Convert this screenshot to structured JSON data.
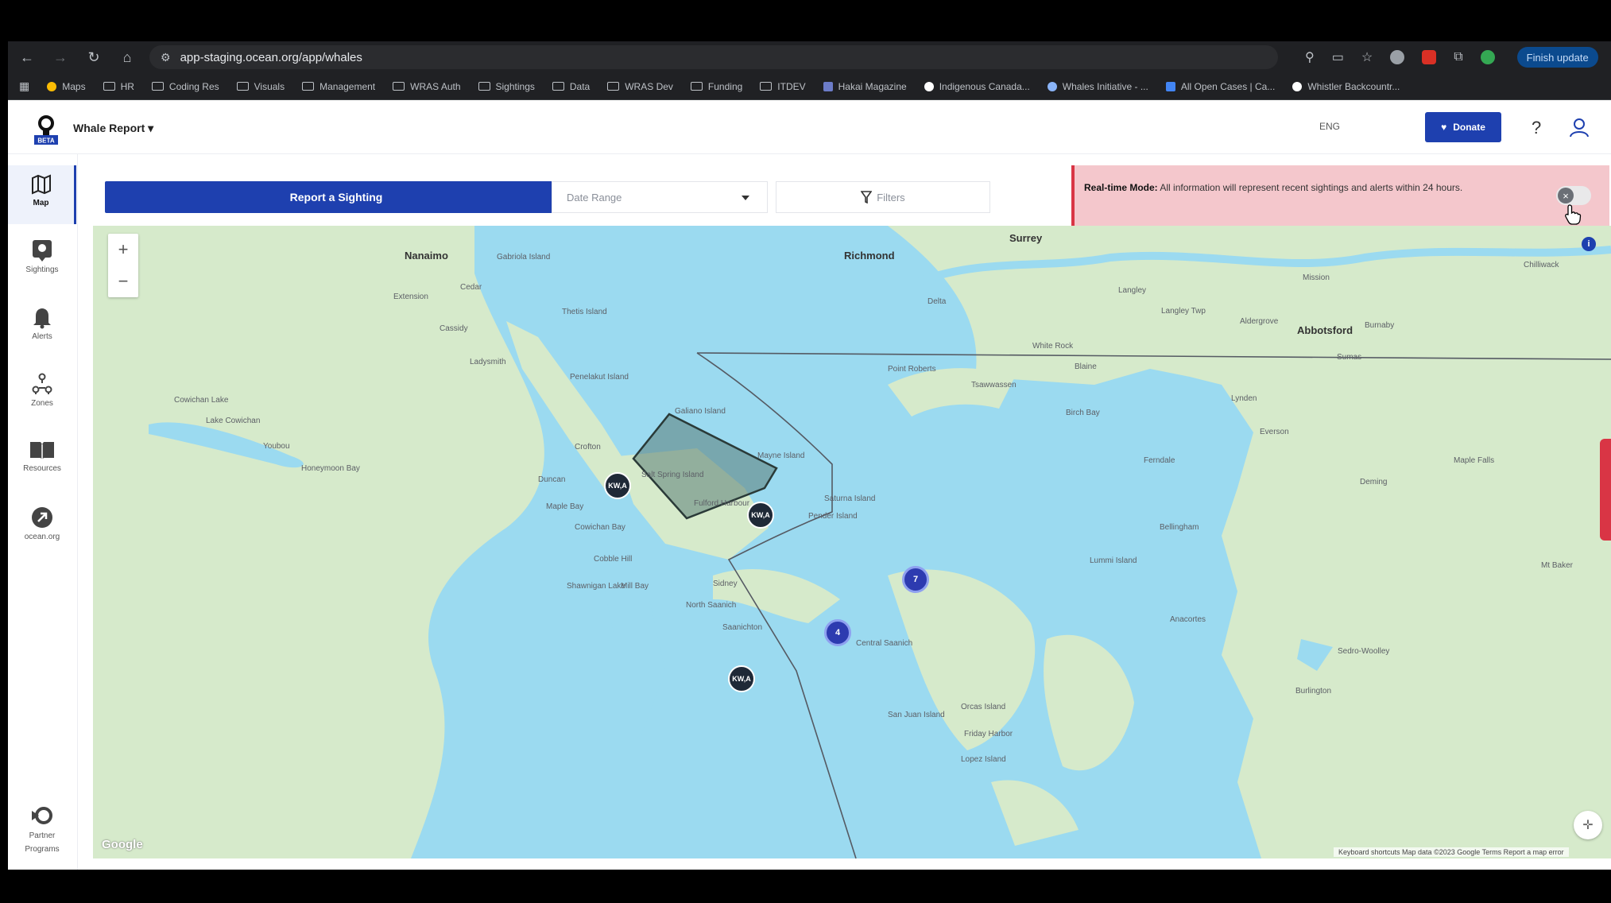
{
  "browser": {
    "url": "app-staging.ocean.org/app/whales",
    "update_label": "Finish update",
    "bookmarks": [
      "Maps",
      "HR",
      "Coding Res",
      "Visuals",
      "Management",
      "WRAS Auth",
      "Sightings",
      "Data",
      "WRAS Dev",
      "Funding",
      "ITDEV",
      "Hakai Magazine",
      "Indigenous Canada...",
      "Whales Initiative - ...",
      "All Open Cases | Ca...",
      "Whistler Backcountr..."
    ]
  },
  "app": {
    "logo_badge": "BETA",
    "title": "Whale Report",
    "language": "ENG",
    "donate_label": "Donate",
    "help_label": "?"
  },
  "sidebar": {
    "items": [
      {
        "label": "Map",
        "icon": "map-icon"
      },
      {
        "label": "Sightings",
        "icon": "location-pin-icon"
      },
      {
        "label": "Alerts",
        "icon": "bell-icon"
      },
      {
        "label": "Zones",
        "icon": "zones-icon"
      },
      {
        "label": "Resources",
        "icon": "book-icon"
      },
      {
        "label": "ocean.org",
        "icon": "external-link-icon"
      }
    ],
    "partner_label_1": "Partner",
    "partner_label_2": "Programs"
  },
  "toolbar": {
    "report_label": "Report a Sighting",
    "date_placeholder": "Date Range",
    "filters_label": "Filters"
  },
  "realtime": {
    "bold": "Real-time Mode:",
    "text": "All information will represent recent sightings and alerts within 24 hours."
  },
  "map": {
    "zoom_in": "+",
    "zoom_out": "−",
    "info": "i",
    "google": "Google",
    "attribution": "Keyboard shortcuts   Map data ©2023 Google   Terms   Report a map error",
    "markers": [
      "KW,A",
      "KW,A",
      "KW,A"
    ],
    "clusters": [
      "7",
      "4"
    ],
    "places_big": [
      "Nanaimo",
      "Richmond",
      "Surrey",
      "Abbotsford"
    ],
    "places": [
      "Gabriola Island",
      "Cedar",
      "Extension",
      "Cassidy",
      "Ladysmith",
      "Thetis Island",
      "Penelakut Island",
      "Galiano Island",
      "Salt Spring Island",
      "Crofton",
      "Duncan",
      "Maple Bay",
      "Cowichan Bay",
      "Mayne Island",
      "Saturna Island",
      "Pender Island",
      "Sidney",
      "North Saanich",
      "Saanichton",
      "Fulford Harbour",
      "Mill Bay",
      "Shawnigan Lake",
      "Cobble Hill",
      "Delta",
      "White Rock",
      "Point Roberts",
      "Tsawwassen",
      "Blaine",
      "Birch Bay",
      "Ferndale",
      "Bellingham",
      "Lummi Island",
      "Langley",
      "Langley Twp",
      "Aldergrove",
      "Sumas",
      "Lynden",
      "Everson",
      "Deming",
      "Sedro-Woolley",
      "Burlington",
      "Anacortes",
      "Friday Harbor",
      "Orcas Island",
      "Lopez Island",
      "San Juan Island",
      "Central Saanich",
      "Lake Cowichan",
      "Youbou",
      "Honeymoon Bay",
      "Cowichan Lake",
      "Mission",
      "Chilliwack",
      "Burnaby",
      "Maple Falls",
      "Mt Baker"
    ]
  },
  "colors": {
    "brand": "#1e40af",
    "water": "#9bdaf0",
    "land": "#d6eacb",
    "alert_bg": "#f4c7cc",
    "alert_accent": "#d93545"
  }
}
